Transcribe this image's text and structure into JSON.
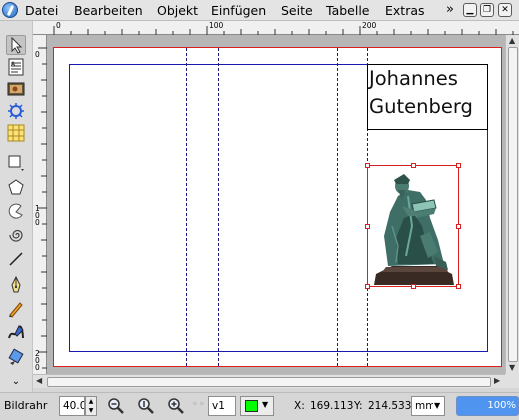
{
  "menubar": {
    "items": [
      "Datei",
      "Bearbeiten",
      "Objekt",
      "Einfügen",
      "Seite",
      "Tabelle",
      "Extras"
    ],
    "more": "»"
  },
  "toolbar": {
    "tools": [
      "select-tool",
      "text-frame-tool",
      "image-frame-tool",
      "render-frame-tool",
      "table-tool",
      "shape-tool",
      "polygon-tool",
      "arc-tool",
      "spiral-tool",
      "line-tool",
      "bezier-tool",
      "freehand-tool",
      "calligraphic-tool",
      "rotate-tool",
      "more-tools"
    ]
  },
  "rulers": {
    "top_labels": [
      "0",
      "100",
      "200"
    ],
    "left_labels": [
      "0",
      "100",
      "200"
    ]
  },
  "document": {
    "text_frame_content": "Johannes Gutenberg",
    "image_frame": "gutenberg-statue-image"
  },
  "statusbar": {
    "mode_label": "Bildrahr",
    "zoom_value": "40.0",
    "layer": "v1",
    "layer_color": "#00ff00",
    "x_label": "X:",
    "x_value": "169.113",
    "y_label": "Y:",
    "y_value": "214.533",
    "unit": "mm",
    "progress": "100%"
  }
}
